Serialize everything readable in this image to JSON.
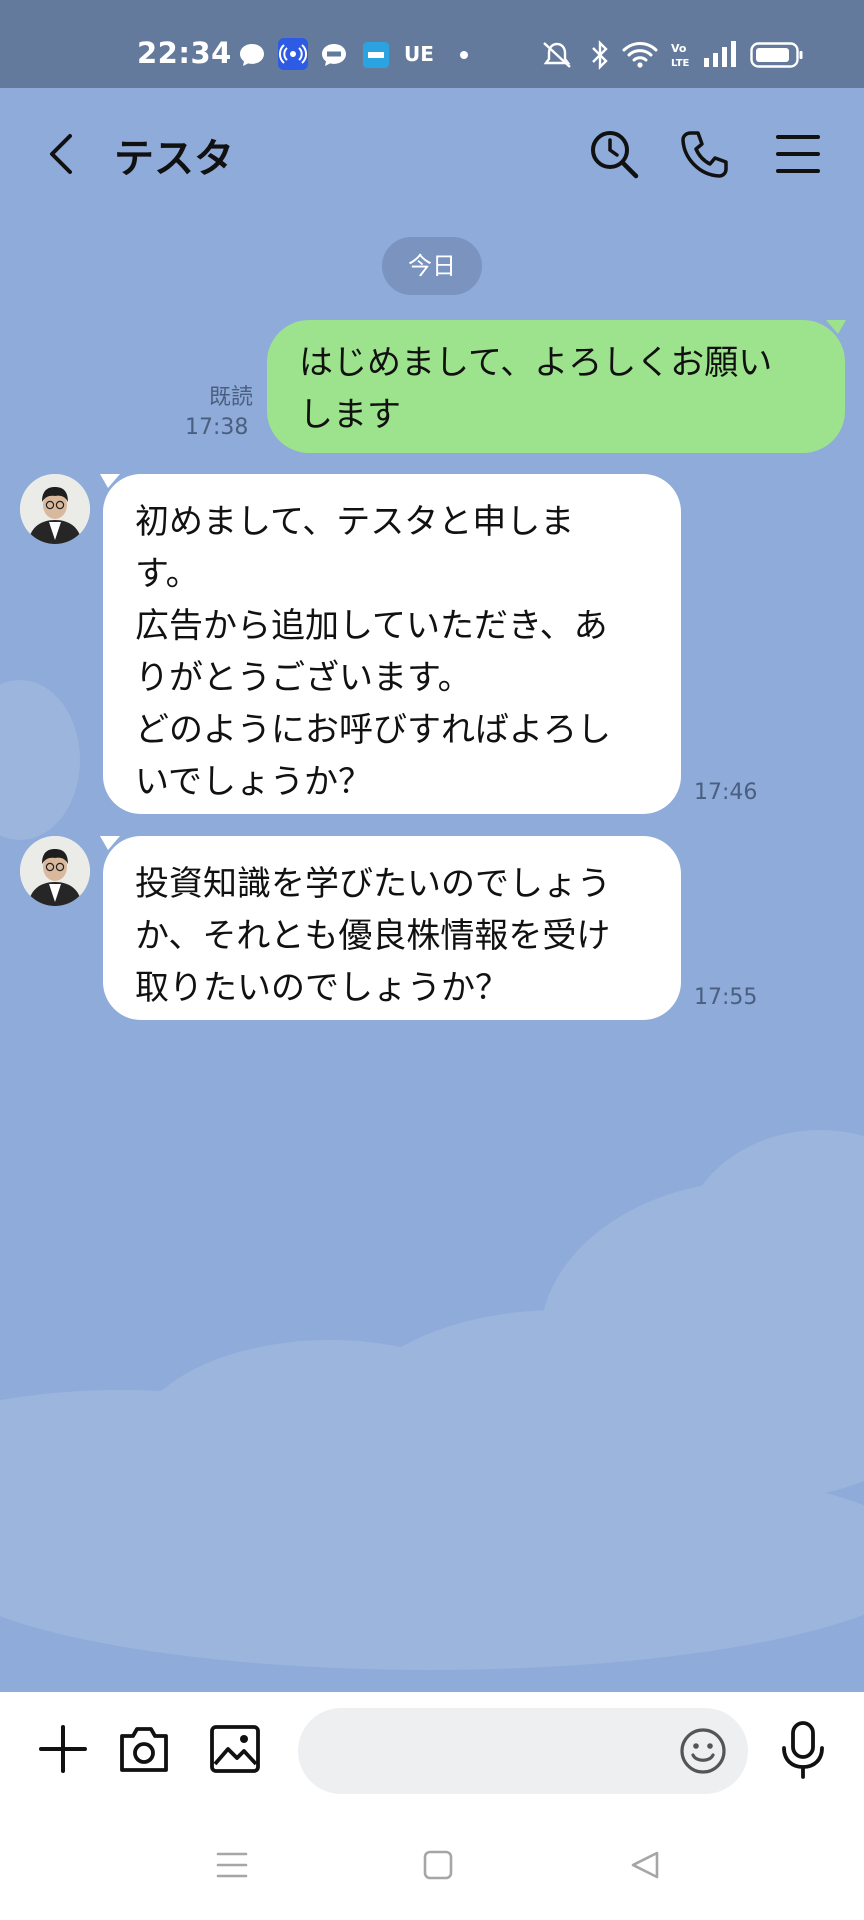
{
  "status_bar": {
    "time": "22:34",
    "ue_label": "UE",
    "icons": [
      "chat-bubble-icon",
      "broadcast-icon",
      "line-icon",
      "app-icon",
      "ue-icon",
      "dot-icon",
      "mute-icon",
      "bluetooth-icon",
      "wifi-icon",
      "volte-icon",
      "signal-icon",
      "battery-icon"
    ]
  },
  "header": {
    "title": "テスタ",
    "icons": [
      "back-icon",
      "search-history-icon",
      "phone-icon",
      "menu-icon"
    ]
  },
  "chat": {
    "date_label": "今日",
    "messages": [
      {
        "direction": "outgoing",
        "lines": [
          "はじめまして、よろしくお願い",
          "します"
        ],
        "read_label": "既読",
        "time": "17:38"
      },
      {
        "direction": "incoming",
        "lines": [
          "初めまして、テスタと申しま",
          "す。",
          "広告から追加していただき、あ",
          "りがとうございます。",
          "どのようにお呼びすればよろし",
          "いでしょうか？"
        ],
        "time": "17:46"
      },
      {
        "direction": "incoming",
        "lines": [
          "投資知識を学びたいのでしょう",
          "か、それとも優良株情報を受け",
          "取りたいのでしょうか？"
        ],
        "time": "17:55"
      }
    ]
  },
  "input_bar": {
    "placeholder": "",
    "icons": [
      "plus-icon",
      "camera-icon",
      "image-icon",
      "emoji-icon",
      "microphone-icon"
    ]
  },
  "nav_bar": {
    "icons": [
      "menu-nav-icon",
      "home-nav-icon",
      "back-nav-icon"
    ]
  },
  "colors": {
    "background": "#8eabd9",
    "status_bar": "#637a9c",
    "outgoing_bubble": "#9de28c",
    "incoming_bubble": "#ffffff"
  }
}
